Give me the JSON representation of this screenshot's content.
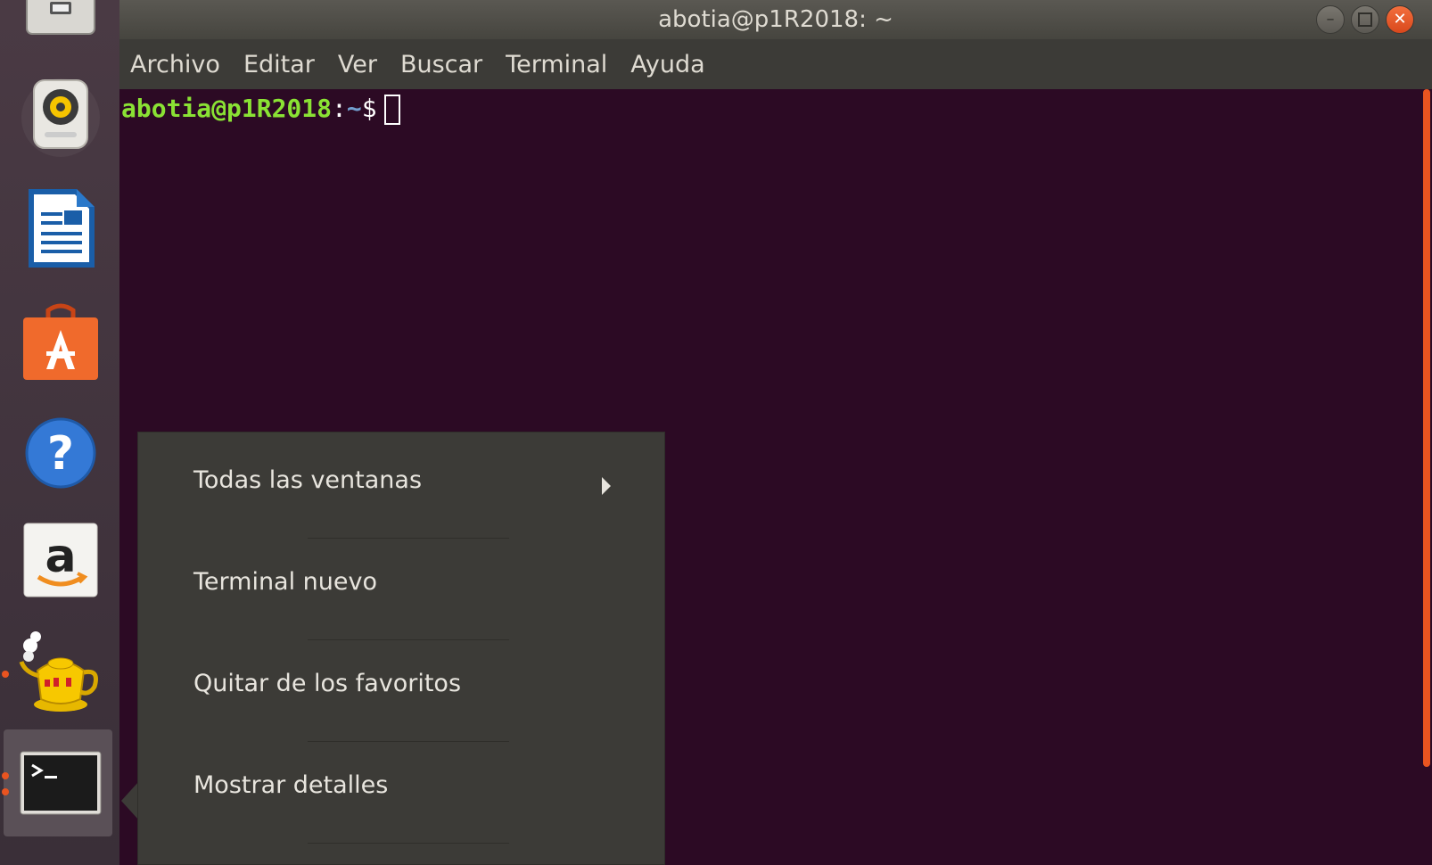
{
  "window": {
    "title": "abotia@p1R2018: ~"
  },
  "menubar": [
    "Archivo",
    "Editar",
    "Ver",
    "Buscar",
    "Terminal",
    "Ayuda"
  ],
  "terminal": {
    "user_host": "abotia@p1R2018",
    "separator": ":",
    "path": "~",
    "prompt_char": "$"
  },
  "context_menu": {
    "items": [
      "Todas las ventanas",
      "Terminal nuevo",
      "Quitar de los favoritos",
      "Mostrar detalles"
    ]
  },
  "dock": {
    "items": [
      "files-icon",
      "rhythmbox-icon",
      "libreoffice-writer-icon",
      "software-center-icon",
      "help-icon",
      "amazon-icon",
      "teapot-app-icon",
      "terminal-icon"
    ]
  },
  "colors": {
    "terminal_bg": "#2c0a24",
    "accent": "#e95420",
    "prompt_user": "#8ae234",
    "prompt_path": "#729fcf"
  }
}
